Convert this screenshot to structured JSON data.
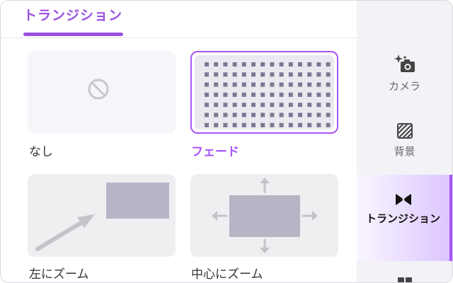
{
  "header": {
    "title": "トランジション"
  },
  "transitions": [
    {
      "label": "なし",
      "icon": "prohibit-icon",
      "selected": false
    },
    {
      "label": "フェード",
      "icon": "dot-grid-icon",
      "selected": true
    },
    {
      "label": "左にズーム",
      "icon": "zoom-left-icon",
      "selected": false
    },
    {
      "label": "中心にズーム",
      "icon": "zoom-center-icon",
      "selected": false
    }
  ],
  "sidebar": {
    "items": [
      {
        "label": "カメラ",
        "icon": "camera-sparkle-icon"
      },
      {
        "label": "背景",
        "icon": "background-pattern-icon"
      },
      {
        "label": "トランジション",
        "icon": "bowtie-icon",
        "active": true
      },
      {
        "label": "",
        "icon": "grid-icon"
      }
    ]
  },
  "colors": {
    "accent": "#a855f7",
    "accent_text": "#9b51e0",
    "sidebar_bg": "#f3f2f7"
  }
}
